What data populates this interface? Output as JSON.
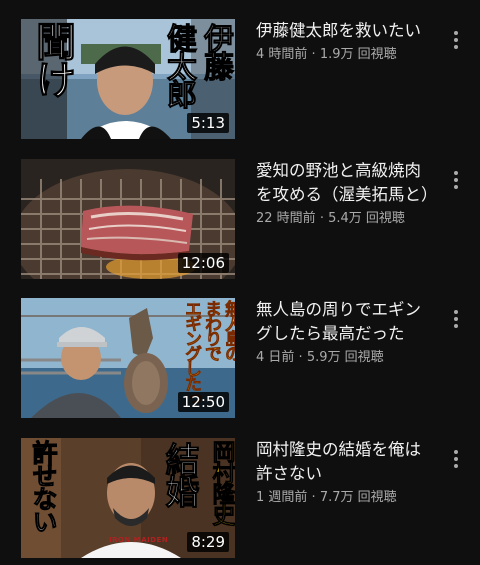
{
  "videos": [
    {
      "title": "伊藤健太郎を救いたい",
      "time_ago": "4 時間前",
      "views": "1.9万 回視聴",
      "separator": "·",
      "duration": "5:13",
      "thumb_text_left": "聞け",
      "thumb_text_right_a": "健太郎",
      "thumb_text_right_b": "伊藤"
    },
    {
      "title": "愛知の野池と高級焼肉を攻める（渥美拓馬と）",
      "time_ago": "22 時間前",
      "views": "5.4万 回視聴",
      "separator": "·",
      "duration": "12:06"
    },
    {
      "title": "無人島の周りでエギングしたら最高だった",
      "time_ago": "4 日前",
      "views": "5.9万 回視聴",
      "separator": "·",
      "duration": "12:50",
      "thumb_text_a": "無人島の",
      "thumb_text_b": "まわりで",
      "thumb_text_c": "エギングしたっ"
    },
    {
      "title": "岡村隆史の結婚を俺は許さない",
      "time_ago": "1 週間前",
      "views": "7.7万 回視聴",
      "separator": "·",
      "duration": "8:29",
      "thumb_text_left": "許せない",
      "thumb_text_mid": "結婚",
      "thumb_text_right": "岡村隆史",
      "shirt_text": "IRON MAIDEN"
    }
  ],
  "colors": {
    "background": "#0f0f0f",
    "title": "#f1f1f1",
    "secondary": "#aaaaaa"
  },
  "icons": {
    "menu": "more-vert-icon"
  }
}
